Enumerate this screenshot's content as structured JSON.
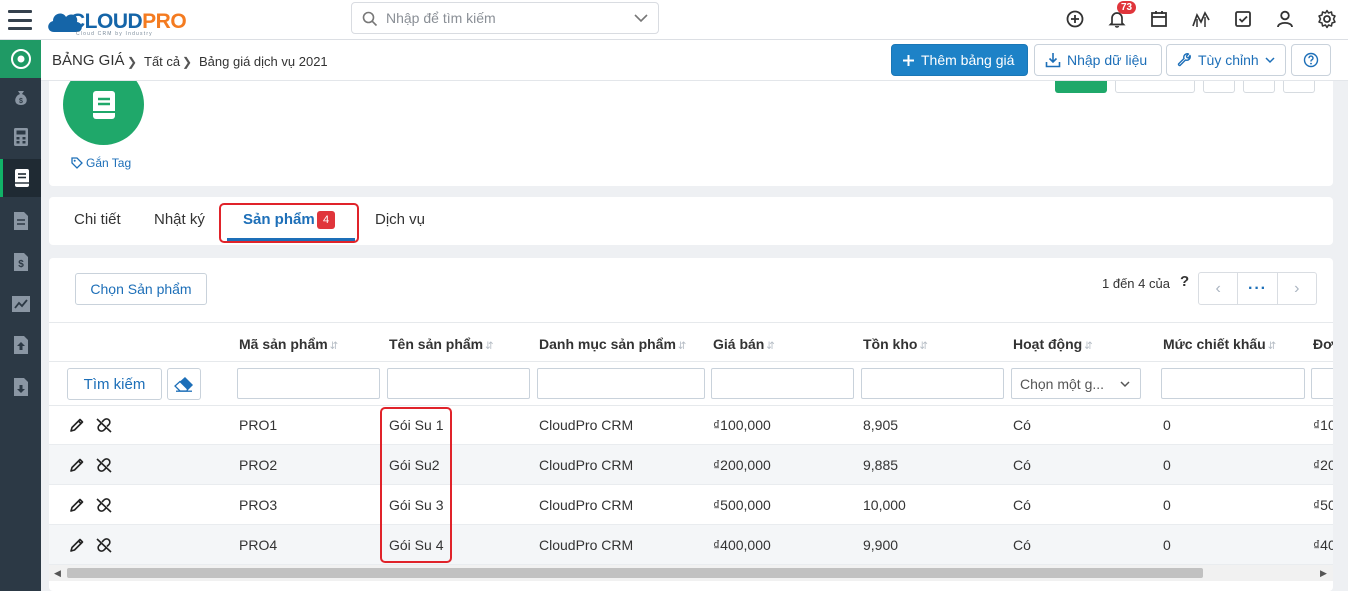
{
  "search": {
    "placeholder": "Nhập để tìm kiếm"
  },
  "notifications": {
    "count": "73"
  },
  "brand": {
    "primary": "#1d82c7",
    "accent": "#1fa86a",
    "danger": "#e0353b"
  },
  "breadcrumb": {
    "module": "BẢNG GIÁ",
    "level1": "Tất cả",
    "level2": "Bảng giá dịch vụ 2021"
  },
  "toolbar": {
    "add_label": "Thêm bảng giá",
    "import_label": "Nhập dữ liệu",
    "custom_label": "Tùy chỉnh"
  },
  "record": {
    "tag_label": "Gắn Tag"
  },
  "tabs": [
    {
      "label": "Chi tiết"
    },
    {
      "label": "Nhật ký"
    },
    {
      "label": "Sản phẩm",
      "badge": "4"
    },
    {
      "label": "Dịch vụ"
    }
  ],
  "list": {
    "choose_label": "Chọn Sản phẩm",
    "paging": "1 đến 4 của",
    "paging_help": "?",
    "search_label": "Tìm kiếm",
    "select_placeholder": "Chọn một g...",
    "columns": [
      "Mã sản phẩm",
      "Tên sản phẩm",
      "Danh mục sản phẩm",
      "Giá bán",
      "Tồn kho",
      "Hoạt động",
      "Mức chiết khấu",
      "Đơ"
    ],
    "rows": [
      {
        "code": "PRO1",
        "name": "Gói Su 1",
        "category": "CloudPro CRM",
        "price": "₫100,000",
        "stock": "8,905",
        "active": "Có",
        "discount": "0",
        "cut": "₫10"
      },
      {
        "code": "PRO2",
        "name": "Gói Su2",
        "category": "CloudPro CRM",
        "price": "₫200,000",
        "stock": "9,885",
        "active": "Có",
        "discount": "0",
        "cut": "₫20"
      },
      {
        "code": "PRO3",
        "name": "Gói Su 3",
        "category": "CloudPro CRM",
        "price": "₫500,000",
        "stock": "10,000",
        "active": "Có",
        "discount": "0",
        "cut": "₫50"
      },
      {
        "code": "PRO4",
        "name": "Gói Su 4",
        "category": "CloudPro CRM",
        "price": "₫400,000",
        "stock": "9,900",
        "active": "Có",
        "discount": "0",
        "cut": "₫40"
      }
    ]
  }
}
